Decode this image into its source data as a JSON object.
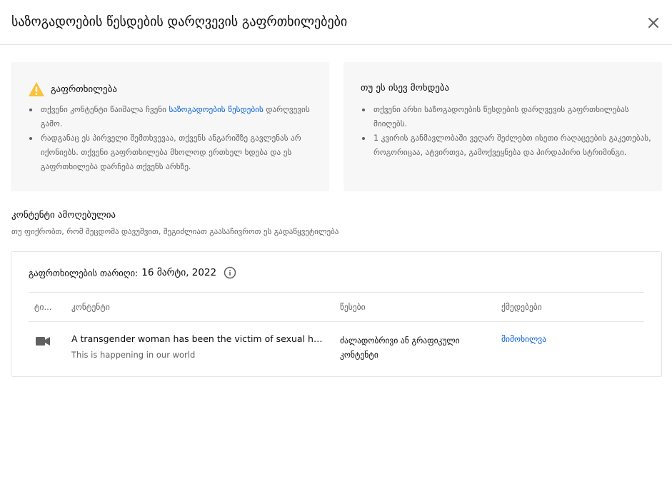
{
  "header": {
    "title": "საზოგადოების წესდების დარღვევის გაფრთხილებები",
    "close_icon": "close-icon"
  },
  "warning_card": {
    "icon": "warning-triangle-icon",
    "icon_color": "#f9c23c",
    "title": "გაფრთხილება",
    "item1_prefix": "თქვენი კონტენტი წაიშალა ჩვენი ",
    "item1_link": "საზოგადოების წესდების",
    "item1_suffix": " დარღვევის გამო.",
    "item2": "რადგანაც ეს პირველი შემთხვევაა, თქვენს ანგარიშზე გავლენას არ იქონიებს. თქვენი გაფრთხილება მხოლოდ ერთხელ ხდება და ეს გაფრთხილება დარჩება თქვენს არხზე."
  },
  "repeat_card": {
    "title": "თუ ეს ისევ მოხდება",
    "item1": "თქვენი არხი საზოგადოების წესდების დარღვევის გაფრთხილებას მიიღებს.",
    "item2": "1 კვირის განმავლობაში ვეღარ შეძლებთ ისეთი რაღაცეების გაკეთებას, როგორიცაა, ატვირთვა, გამოქვეყნება და პირდაპირი სტრიმინგი."
  },
  "removed": {
    "title": "კონტენტი ამოღებულია",
    "subtitle": "თუ ფიქრობთ, რომ შეცდომა დავუშვით, შეგიძლიათ გაასაჩივროთ ეს გადაწყვეტილება"
  },
  "panel": {
    "date_label": "გაფრთხილების თარიღი:",
    "date_value": "16 მარტი, 2022",
    "info_icon": "info-icon",
    "columns": {
      "type": "ტი...",
      "content": "კონტენტი",
      "policy": "წესები",
      "actions": "ქმედებები"
    },
    "row": {
      "type_icon": "video-camera-icon",
      "title": "A transgender woman has been the victim of sexual harass...",
      "subtitle": "This is happening in our world",
      "policy": "ძალადობრივი ან გრაფიკული კონტენტი",
      "action": "მიმოხილვა"
    }
  },
  "colors": {
    "link": "#065fd4",
    "card_bg": "#f7f7f7",
    "secondary_text": "#606060"
  }
}
